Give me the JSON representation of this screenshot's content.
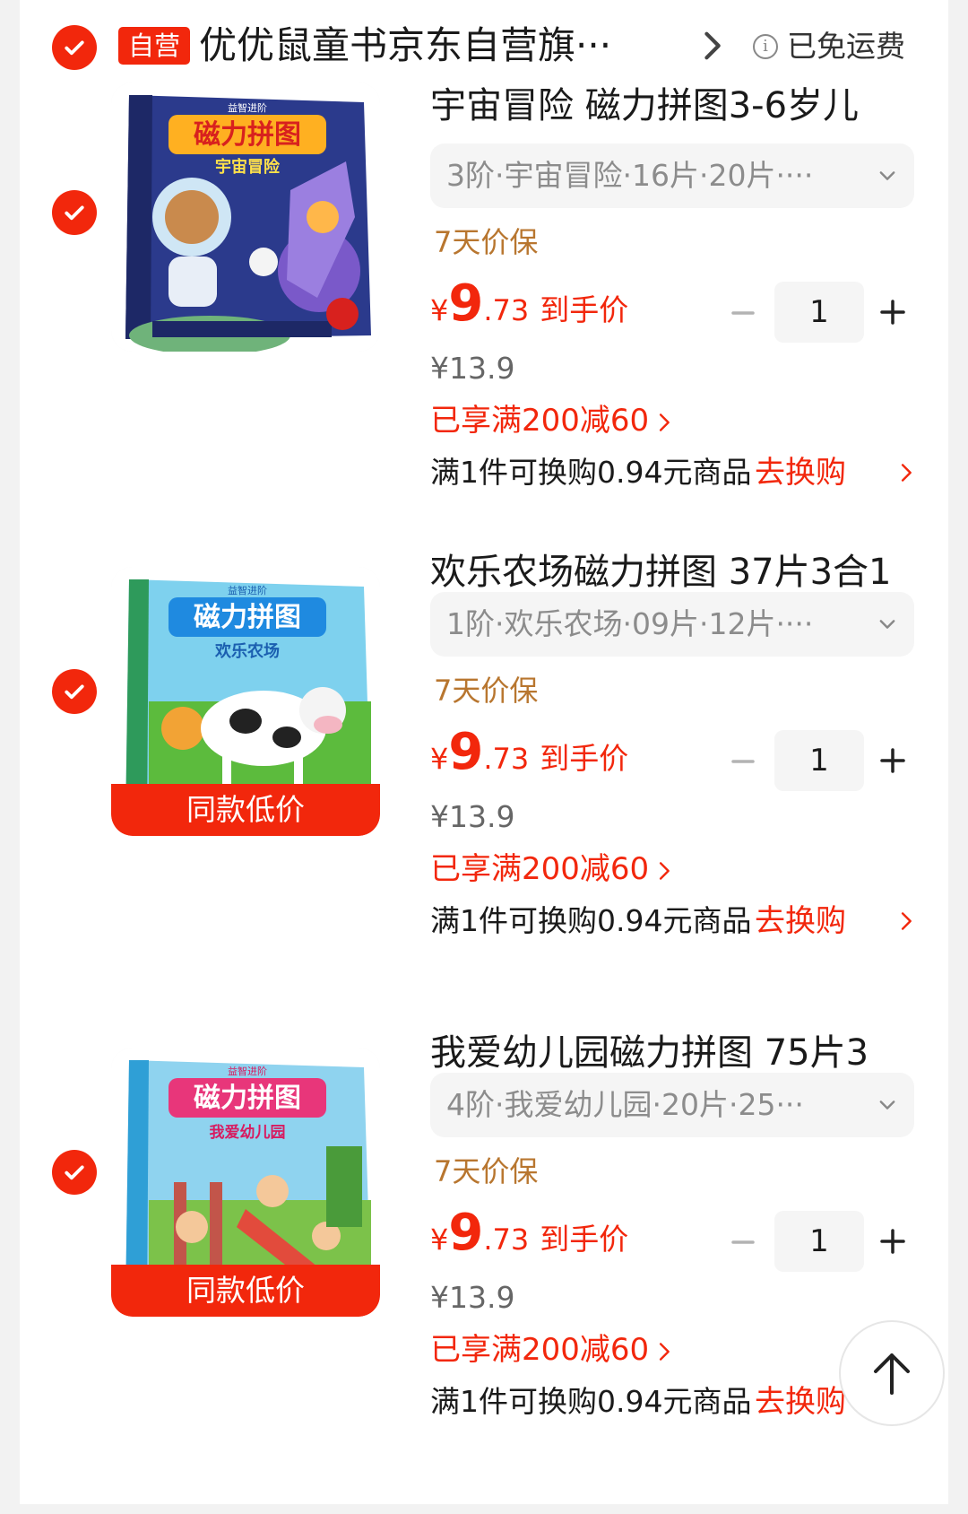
{
  "shop": {
    "badge": "自营",
    "name": "优优鼠童书京东自营旗···",
    "shipping": "已免运费"
  },
  "items": [
    {
      "title": "宇宙冒险 磁力拼图3-6岁儿",
      "spec": "3阶·宇宙冒险·16片·20片····",
      "guarantee": "7天价保",
      "price_symbol": "¥",
      "price_int": "9",
      "price_dec": ".73",
      "price_tag": "到手价",
      "quantity": "1",
      "original_price": "¥13.9",
      "promo": "已享满200减60",
      "exchange_text": "满1件可换购0.94元商品",
      "exchange_link": "去换购",
      "cover_title": "磁力拼图",
      "cover_subtitle": "宇宙冒险",
      "cover_label": "益智进阶",
      "low_price_badge": ""
    },
    {
      "title": "欢乐农场磁力拼图 37片3合1",
      "spec": "1阶·欢乐农场·09片·12片····",
      "guarantee": "7天价保",
      "price_symbol": "¥",
      "price_int": "9",
      "price_dec": ".73",
      "price_tag": "到手价",
      "quantity": "1",
      "original_price": "¥13.9",
      "promo": "已享满200减60",
      "exchange_text": "满1件可换购0.94元商品",
      "exchange_link": "去换购",
      "cover_title": "磁力拼图",
      "cover_subtitle": "欢乐农场",
      "cover_label": "益智进阶",
      "low_price_badge": "同款低价"
    },
    {
      "title": "我爱幼儿园磁力拼图 75片3",
      "spec": "4阶·我爱幼儿园·20片·25···",
      "guarantee": "7天价保",
      "price_symbol": "¥",
      "price_int": "9",
      "price_dec": ".73",
      "price_tag": "到手价",
      "quantity": "1",
      "original_price": "¥13.9",
      "promo": "已享满200减60",
      "exchange_text": "满1件可换购0.94元商品",
      "exchange_link": "去换购",
      "cover_title": "磁力拼图",
      "cover_subtitle": "我爱幼儿园",
      "cover_label": "益智进阶",
      "low_price_badge": "同款低价"
    }
  ],
  "icons": {
    "check": "checkmark-icon",
    "chevron_right": "chevron-right-icon",
    "chevron_down": "chevron-down-icon",
    "info": "info-icon",
    "minus": "minus-icon",
    "plus": "plus-icon",
    "scroll_top": "arrow-up-icon"
  },
  "colors": {
    "accent": "#f2270c",
    "guarantee": "#b8762f",
    "muted": "#8c8c8c"
  }
}
